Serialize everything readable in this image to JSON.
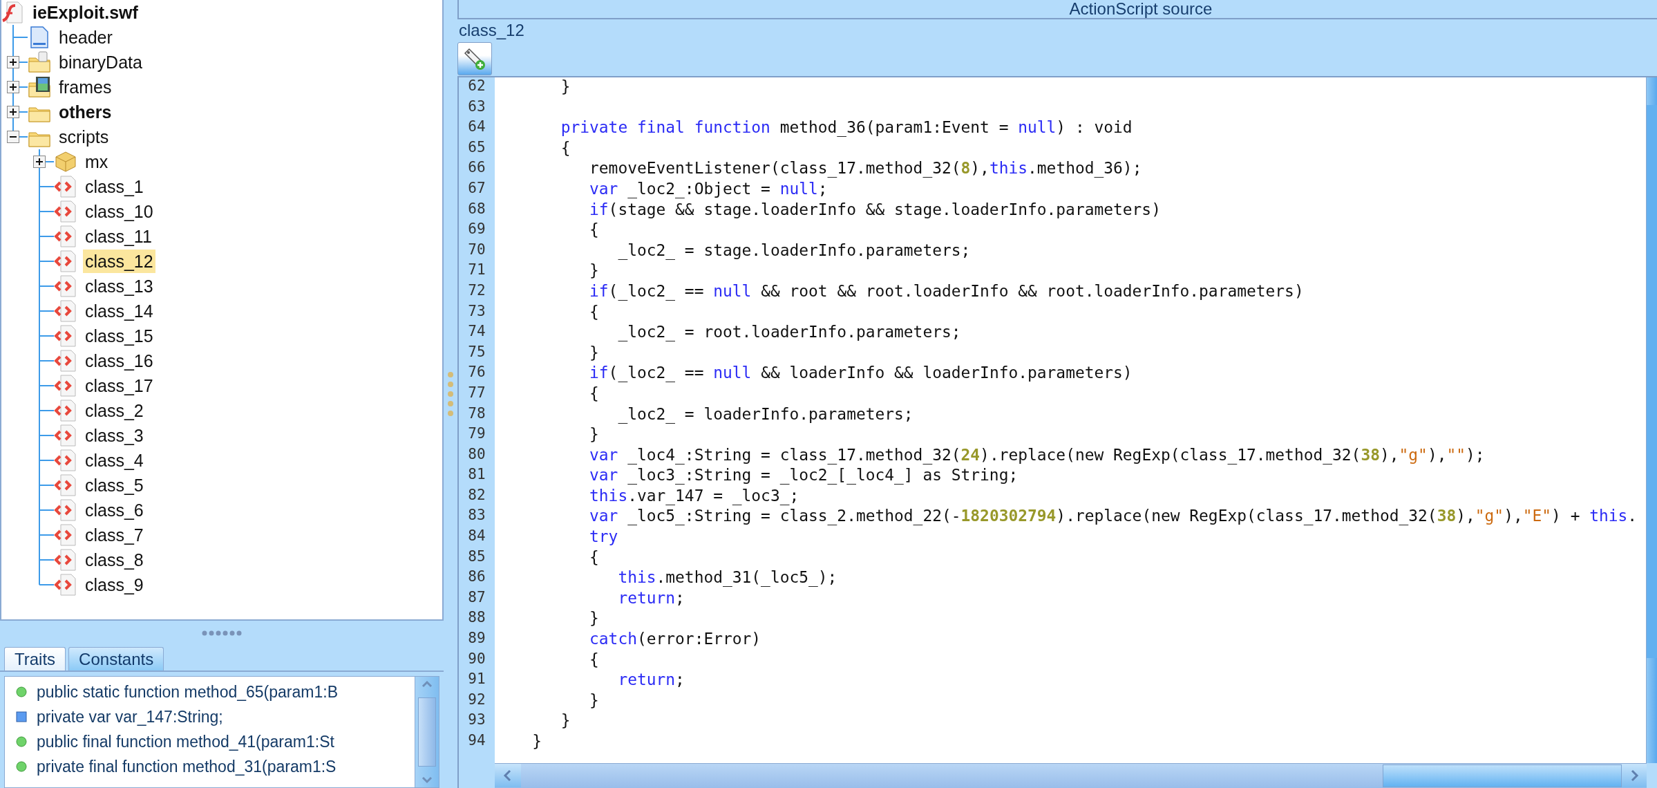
{
  "tree": [
    {
      "label": "ieExploit.swf",
      "kind": "swf",
      "bold": true,
      "selected": false,
      "children": [
        {
          "label": "header",
          "kind": "header",
          "bold": false,
          "selected": false
        },
        {
          "label": "binaryData",
          "kind": "binary-folder",
          "bold": false,
          "selected": false,
          "expanded": false
        },
        {
          "label": "frames",
          "kind": "frames-folder",
          "bold": false,
          "selected": false,
          "expanded": false
        },
        {
          "label": "others",
          "kind": "folder",
          "bold": true,
          "selected": false,
          "expanded": false
        },
        {
          "label": "scripts",
          "kind": "folder",
          "bold": false,
          "selected": false,
          "expanded": true,
          "children": [
            {
              "label": "mx",
              "kind": "package",
              "bold": false,
              "selected": false,
              "expanded": false
            },
            {
              "label": "class_1",
              "kind": "script",
              "bold": false,
              "selected": false
            },
            {
              "label": "class_10",
              "kind": "script",
              "bold": false,
              "selected": false
            },
            {
              "label": "class_11",
              "kind": "script",
              "bold": false,
              "selected": false
            },
            {
              "label": "class_12",
              "kind": "script",
              "bold": false,
              "selected": true
            },
            {
              "label": "class_13",
              "kind": "script",
              "bold": false,
              "selected": false
            },
            {
              "label": "class_14",
              "kind": "script",
              "bold": false,
              "selected": false
            },
            {
              "label": "class_15",
              "kind": "script",
              "bold": false,
              "selected": false
            },
            {
              "label": "class_16",
              "kind": "script",
              "bold": false,
              "selected": false
            },
            {
              "label": "class_17",
              "kind": "script",
              "bold": false,
              "selected": false
            },
            {
              "label": "class_2",
              "kind": "script",
              "bold": false,
              "selected": false
            },
            {
              "label": "class_3",
              "kind": "script",
              "bold": false,
              "selected": false
            },
            {
              "label": "class_4",
              "kind": "script",
              "bold": false,
              "selected": false
            },
            {
              "label": "class_5",
              "kind": "script",
              "bold": false,
              "selected": false
            },
            {
              "label": "class_6",
              "kind": "script",
              "bold": false,
              "selected": false
            },
            {
              "label": "class_7",
              "kind": "script",
              "bold": false,
              "selected": false
            },
            {
              "label": "class_8",
              "kind": "script",
              "bold": false,
              "selected": false
            },
            {
              "label": "class_9",
              "kind": "script",
              "bold": false,
              "selected": false
            }
          ]
        }
      ]
    }
  ],
  "tabs": [
    {
      "label": "Traits",
      "selected": true
    },
    {
      "label": "Constants",
      "selected": false
    }
  ],
  "traits": [
    {
      "kind": "method",
      "text": "public static function method_65(param1:B"
    },
    {
      "kind": "var",
      "text": "private var var_147:String;"
    },
    {
      "kind": "method",
      "text": "public final function method_41(param1:St"
    },
    {
      "kind": "method",
      "text": "private final function method_31(param1:S"
    }
  ],
  "source": {
    "title": "ActionScript source",
    "class_name": "class_12",
    "lines": [
      {
        "number": "62",
        "tokens": [
          {
            "kind": "plain",
            "text": "      }"
          }
        ]
      },
      {
        "number": "63"
      },
      {
        "number": "64",
        "tokens": [
          {
            "kind": "keyword",
            "text": "      private final function"
          },
          {
            "kind": "plain",
            "text": " method_36(param1:Event = "
          },
          {
            "kind": "keyword",
            "text": "null"
          },
          {
            "kind": "plain",
            "text": ") : void"
          }
        ]
      },
      {
        "number": "65",
        "tokens": [
          {
            "kind": "plain",
            "text": "      {"
          }
        ]
      },
      {
        "number": "66",
        "tokens": [
          {
            "kind": "plain",
            "text": "         removeEventListener(class_17.method_32("
          },
          {
            "kind": "number",
            "text": "8"
          },
          {
            "kind": "plain",
            "text": "),"
          },
          {
            "kind": "keyword",
            "text": "this"
          },
          {
            "kind": "plain",
            "text": ".method_36);"
          }
        ]
      },
      {
        "number": "67",
        "tokens": [
          {
            "kind": "keyword",
            "text": "         var"
          },
          {
            "kind": "plain",
            "text": " _loc2_:Object = "
          },
          {
            "kind": "keyword",
            "text": "null"
          },
          {
            "kind": "plain",
            "text": ";"
          }
        ]
      },
      {
        "number": "68",
        "tokens": [
          {
            "kind": "keyword",
            "text": "         if"
          },
          {
            "kind": "plain",
            "text": "(stage && stage.loaderInfo && stage.loaderInfo.parameters)"
          }
        ]
      },
      {
        "number": "69",
        "tokens": [
          {
            "kind": "plain",
            "text": "         {"
          }
        ]
      },
      {
        "number": "70",
        "tokens": [
          {
            "kind": "plain",
            "text": "            _loc2_ = stage.loaderInfo.parameters;"
          }
        ]
      },
      {
        "number": "71",
        "tokens": [
          {
            "kind": "plain",
            "text": "         }"
          }
        ]
      },
      {
        "number": "72",
        "tokens": [
          {
            "kind": "keyword",
            "text": "         if"
          },
          {
            "kind": "plain",
            "text": "(_loc2_ == "
          },
          {
            "kind": "keyword",
            "text": "null"
          },
          {
            "kind": "plain",
            "text": " && root && root.loaderInfo && root.loaderInfo.parameters)"
          }
        ]
      },
      {
        "number": "73",
        "tokens": [
          {
            "kind": "plain",
            "text": "         {"
          }
        ]
      },
      {
        "number": "74",
        "tokens": [
          {
            "kind": "plain",
            "text": "            _loc2_ = root.loaderInfo.parameters;"
          }
        ]
      },
      {
        "number": "75",
        "tokens": [
          {
            "kind": "plain",
            "text": "         }"
          }
        ]
      },
      {
        "number": "76",
        "tokens": [
          {
            "kind": "keyword",
            "text": "         if"
          },
          {
            "kind": "plain",
            "text": "(_loc2_ == "
          },
          {
            "kind": "keyword",
            "text": "null"
          },
          {
            "kind": "plain",
            "text": " && loaderInfo && loaderInfo.parameters)"
          }
        ]
      },
      {
        "number": "77",
        "tokens": [
          {
            "kind": "plain",
            "text": "         {"
          }
        ]
      },
      {
        "number": "78",
        "tokens": [
          {
            "kind": "plain",
            "text": "            _loc2_ = loaderInfo.parameters;"
          }
        ]
      },
      {
        "number": "79",
        "tokens": [
          {
            "kind": "plain",
            "text": "         }"
          }
        ]
      },
      {
        "number": "80",
        "tokens": [
          {
            "kind": "keyword",
            "text": "         var"
          },
          {
            "kind": "plain",
            "text": " _loc4_:String = class_17.method_32("
          },
          {
            "kind": "number",
            "text": "24"
          },
          {
            "kind": "plain",
            "text": ").replace(new RegExp(class_17.method_32("
          },
          {
            "kind": "number",
            "text": "38"
          },
          {
            "kind": "plain",
            "text": "),"
          },
          {
            "kind": "string",
            "text": "\"g\""
          },
          {
            "kind": "plain",
            "text": "),"
          },
          {
            "kind": "string",
            "text": "\"\""
          },
          {
            "kind": "plain",
            "text": ");"
          }
        ]
      },
      {
        "number": "81",
        "tokens": [
          {
            "kind": "keyword",
            "text": "         var"
          },
          {
            "kind": "plain",
            "text": " _loc3_:String = _loc2_[_loc4_] as String;"
          }
        ]
      },
      {
        "number": "82",
        "tokens": [
          {
            "kind": "keyword",
            "text": "         this"
          },
          {
            "kind": "plain",
            "text": ".var_147 = _loc3_;"
          }
        ]
      },
      {
        "number": "83",
        "tokens": [
          {
            "kind": "keyword",
            "text": "         var"
          },
          {
            "kind": "plain",
            "text": " _loc5_:String = class_2.method_22(-"
          },
          {
            "kind": "number",
            "text": "1820302794"
          },
          {
            "kind": "plain",
            "text": ").replace(new RegExp(class_17.method_32("
          },
          {
            "kind": "number",
            "text": "38"
          },
          {
            "kind": "plain",
            "text": "),"
          },
          {
            "kind": "string",
            "text": "\"g\""
          },
          {
            "kind": "plain",
            "text": "),"
          },
          {
            "kind": "string",
            "text": "\"E\""
          },
          {
            "kind": "plain",
            "text": ") + "
          },
          {
            "kind": "keyword",
            "text": "this"
          },
          {
            "kind": "plain",
            "text": "."
          }
        ]
      },
      {
        "number": "84",
        "tokens": [
          {
            "kind": "keyword",
            "text": "         try"
          }
        ]
      },
      {
        "number": "85",
        "tokens": [
          {
            "kind": "plain",
            "text": "         {"
          }
        ]
      },
      {
        "number": "86",
        "tokens": [
          {
            "kind": "keyword",
            "text": "            this"
          },
          {
            "kind": "plain",
            "text": ".method_31(_loc5_);"
          }
        ]
      },
      {
        "number": "87",
        "tokens": [
          {
            "kind": "keyword",
            "text": "            return"
          },
          {
            "kind": "plain",
            "text": ";"
          }
        ]
      },
      {
        "number": "88",
        "tokens": [
          {
            "kind": "plain",
            "text": "         }"
          }
        ]
      },
      {
        "number": "89",
        "tokens": [
          {
            "kind": "keyword",
            "text": "         catch"
          },
          {
            "kind": "plain",
            "text": "(error:Error)"
          }
        ]
      },
      {
        "number": "90",
        "tokens": [
          {
            "kind": "plain",
            "text": "         {"
          }
        ]
      },
      {
        "number": "91",
        "tokens": [
          {
            "kind": "keyword",
            "text": "            return"
          },
          {
            "kind": "plain",
            "text": ";"
          }
        ]
      },
      {
        "number": "92",
        "tokens": [
          {
            "kind": "plain",
            "text": "         }"
          }
        ]
      },
      {
        "number": "93",
        "tokens": [
          {
            "kind": "plain",
            "text": "      }"
          }
        ]
      },
      {
        "number": "94",
        "tokens": [
          {
            "kind": "plain",
            "text": "   }"
          }
        ]
      }
    ]
  }
}
